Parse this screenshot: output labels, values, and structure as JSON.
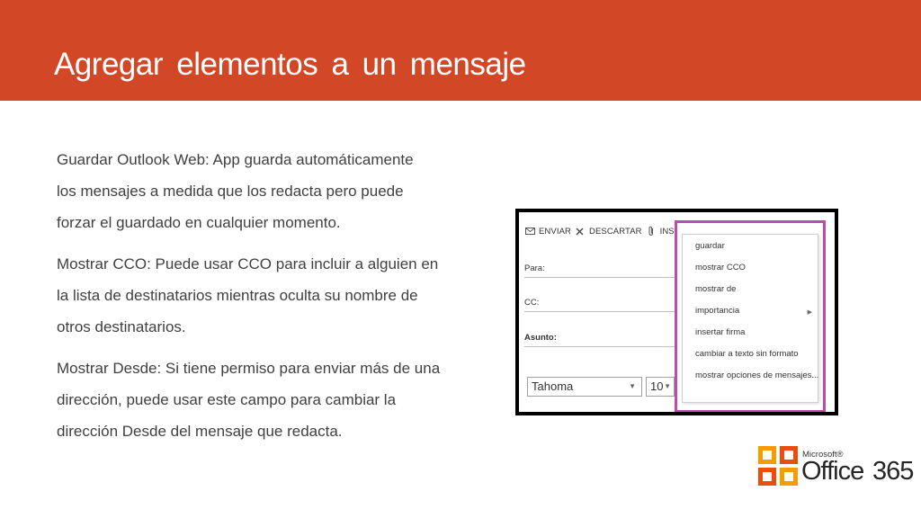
{
  "slide": {
    "title": "Agregar  elementos  a  un  mensaje",
    "paragraphs": [
      {
        "lines": [
          "Guardar Outlook  Web:  App  guarda  automáticamente",
          "los  mensajes  a  medida  que  los redacta pero puede",
          "forzar el guardado en cualquier momento."
        ]
      },
      {
        "lines": [
          "Mostrar CCO: Puede usar CCO para incluir a alguien en",
          "la lista de destinatarios mientras oculta su nombre de",
          "otros destinatarios."
        ]
      },
      {
        "lines": [
          "Mostrar Desde: Si tiene permiso para enviar más de una",
          "dirección, puede usar este campo para cambiar la",
          "dirección Desde del mensaje que redacta."
        ]
      }
    ]
  },
  "screenshot": {
    "toolbar": {
      "send_label": "ENVIAR",
      "discard_label": "DESCARTAR",
      "insert_label": "INSERTAR",
      "more_label": "•••"
    },
    "fields": {
      "to_label": "Para:",
      "cc_label": "CC:",
      "subject_label": "Asunto:"
    },
    "font": {
      "name": "Tahoma",
      "size": "10"
    },
    "menu_items": [
      "guardar",
      "mostrar CCO",
      "mostrar de",
      "importancia",
      "insertar firma",
      "cambiar a texto sin formato",
      "mostrar opciones de mensajes..."
    ],
    "highlight_color": "#c04aab"
  },
  "logo": {
    "microsoft": "Microsoft®",
    "office": "Office",
    "number": "365"
  },
  "colors": {
    "header": "#d24726",
    "body_text": "#404040"
  },
  "icons": {
    "send": "send-icon",
    "discard": "close-icon",
    "attach": "paperclip-icon",
    "submenu": "chevron-right-icon",
    "dropdown": "chevron-down-icon"
  }
}
